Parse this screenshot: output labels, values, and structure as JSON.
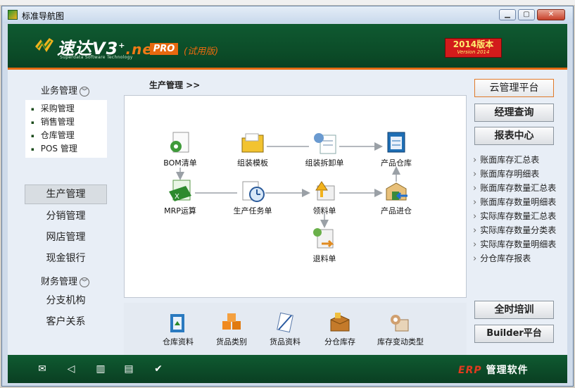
{
  "window": {
    "title": "标准导航图"
  },
  "banner": {
    "logo_text": "速达V3",
    "logo_sup": "+",
    "logo_net": ".net",
    "logo_subtitle": "Superdata Software Technology",
    "pro_badge": "PRO",
    "trial": "(试用版)",
    "version_line1": "2014版本",
    "version_line2": "Version 2014"
  },
  "sidebar": {
    "business_title": "业务管理",
    "business_items": [
      "采购管理",
      "销售管理",
      "仓库管理",
      "POS 管理"
    ],
    "nav": [
      "生产管理",
      "分销管理",
      "网店管理",
      "现金银行"
    ],
    "finance_title": "财务管理",
    "nav2": [
      "分支机构",
      "客户关系"
    ]
  },
  "main": {
    "breadcrumb": "生产管理 >>",
    "nodes": {
      "bom": "BOM清单",
      "assembly_template": "组装模板",
      "assembly_disassembly": "组装拆卸单",
      "product_warehouse": "产品仓库",
      "mrp": "MRP运算",
      "production_task": "生产任务单",
      "material_requisition": "领料单",
      "product_inbound": "产品进仓",
      "material_return": "退料单"
    },
    "tools": [
      "仓库资料",
      "货品类别",
      "货品资料",
      "分仓库存",
      "库存变动类型"
    ]
  },
  "right": {
    "cloud": "云管理平台",
    "manager": "经理查询",
    "reports": "报表中心",
    "report_items": [
      "账面库存汇总表",
      "账面库存明细表",
      "账面库存数量汇总表",
      "账面库存数量明细表",
      "实际库存数量汇总表",
      "实际库存数量分类表",
      "实际库存数量明细表",
      "分仓库存报表"
    ],
    "training": "全时培训",
    "builder": "Builder平台"
  },
  "footer": {
    "erp": "ERP",
    "brand": "管理软件"
  },
  "colors": {
    "banner_green": "#0b4a27",
    "accent_orange": "#e8690f",
    "version_red": "#d21b1b"
  }
}
